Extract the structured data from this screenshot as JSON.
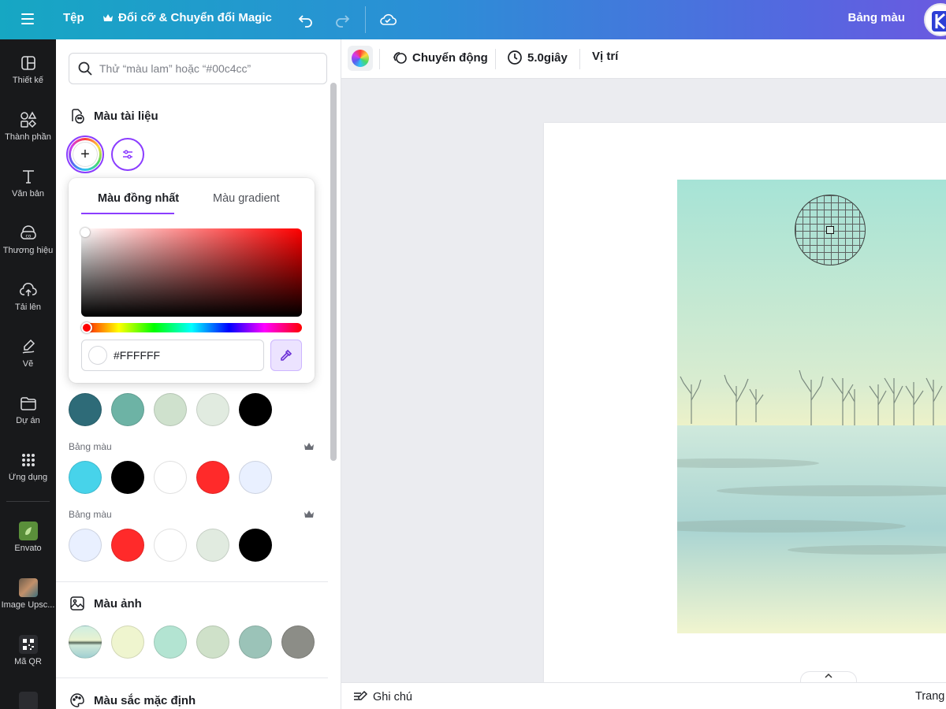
{
  "topbar": {
    "file_label": "Tệp",
    "magic_label": "Đổi cỡ & Chuyển đổi Magic",
    "palette_label": "Bảng màu"
  },
  "rail": {
    "items": [
      {
        "label": "Thiết kế",
        "icon": "layout-icon"
      },
      {
        "label": "Thành phần",
        "icon": "shapes-icon"
      },
      {
        "label": "Văn bản",
        "icon": "text-icon"
      },
      {
        "label": "Thương hiệu",
        "icon": "brand-icon"
      },
      {
        "label": "Tải lên",
        "icon": "upload-icon"
      },
      {
        "label": "Vẽ",
        "icon": "draw-icon"
      },
      {
        "label": "Dự án",
        "icon": "folder-icon"
      },
      {
        "label": "Ứng dụng",
        "icon": "apps-icon"
      },
      {
        "label": "Envato",
        "icon": "envato-icon"
      },
      {
        "label": "Image Upsc...",
        "icon": "image-upscaler-icon"
      },
      {
        "label": "Mã QR",
        "icon": "qr-code-icon"
      }
    ]
  },
  "panel": {
    "search_placeholder": "Thử “màu lam” hoặc “#00c4cc”",
    "doc_colors_title": "Màu tài liệu",
    "palettes": [
      {
        "label": "",
        "colors": [
          "#2e6b78",
          "#6db3a5",
          "#cfe1cd",
          "#e1ebe0",
          "#000000"
        ]
      },
      {
        "label": "Bảng màu",
        "colors": [
          "#47d3ea",
          "#000000",
          "#ffffff",
          "#ff2a2a",
          "#e9f0ff"
        ]
      },
      {
        "label": "Bảng màu",
        "colors": [
          "#e9f0ff",
          "#ff2a2a",
          "#ffffff",
          "#e1ebe0",
          "#000000"
        ]
      }
    ],
    "photo_colors_title": "Màu ảnh",
    "photo_colors": [
      "#eff5cf",
      "#b3e4d2",
      "#cfe1c9",
      "#9bc3b8",
      "#8c8d87"
    ],
    "default_colors_title": "Màu sắc mặc định"
  },
  "picker": {
    "tab_solid": "Màu đồng nhất",
    "tab_gradient": "Màu gradient",
    "hex_value": "#FFFFFF"
  },
  "editbar": {
    "animate_label": "Chuyển động",
    "duration_label": "5.0giây",
    "position_label": "Vị trí"
  },
  "footer": {
    "notes_label": "Ghi chú",
    "pages_label": "Trang"
  },
  "colors": {
    "accent": "#8b3dff",
    "rail_bg": "#18191b"
  }
}
